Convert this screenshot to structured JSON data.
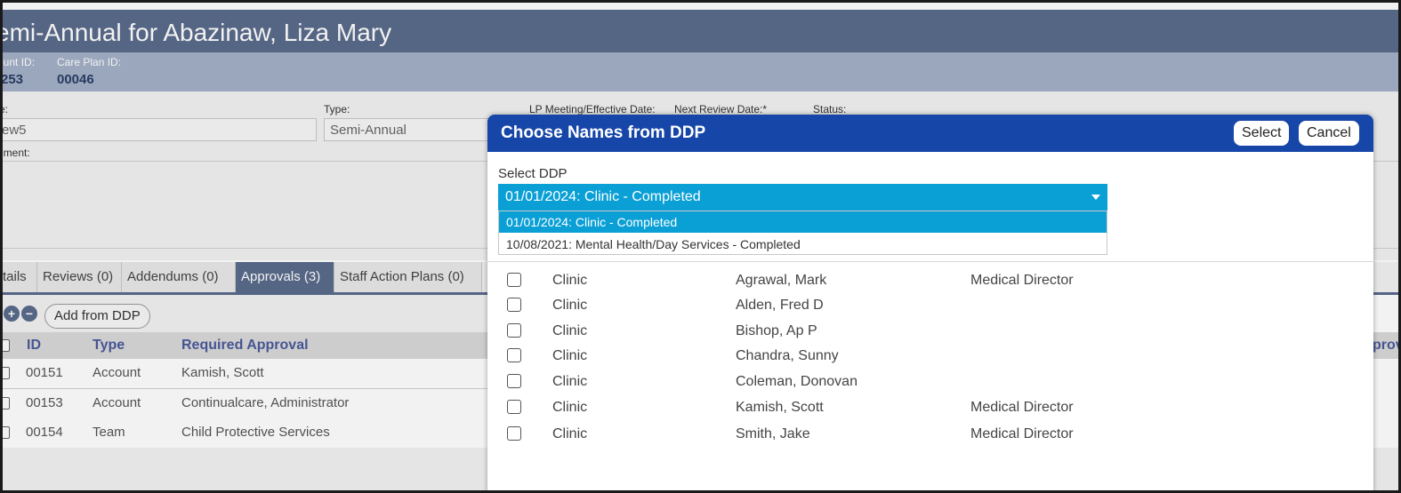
{
  "page": {
    "title": "emi-Annual for Abazinaw, Liza Mary",
    "account_id_label": "ount ID:",
    "account_id_value": "253",
    "care_plan_id_label": "Care Plan ID:",
    "care_plan_id_value": "00046"
  },
  "form": {
    "name_label": "e:",
    "name_value": "ew5",
    "type_label": "Type:",
    "type_value": "Semi-Annual",
    "lp_meeting_label": "LP Meeting/Effective Date:",
    "next_review_label": "Next Review Date:*",
    "status_label": "Status:",
    "comment_label": "nment:"
  },
  "tabs": [
    {
      "label": "tails"
    },
    {
      "label": "Reviews (0)"
    },
    {
      "label": "Addendums (0)"
    },
    {
      "label": "Approvals (3)"
    },
    {
      "label": "Staff Action Plans (0)"
    }
  ],
  "toolbar": {
    "add_icon": "+",
    "remove_icon": "−",
    "add_from_ddp": "Add from DDP"
  },
  "approvals_table": {
    "headers": {
      "id": "ID",
      "type": "Type",
      "required": "Required Approval",
      "right": "prov"
    },
    "rows": [
      {
        "id": "00151",
        "type": "Account",
        "required": "Kamish, Scott"
      },
      {
        "id": "00153",
        "type": "Account",
        "required": "Continualcare, Administrator"
      },
      {
        "id": "00154",
        "type": "Team",
        "required": "Child Protective Services"
      }
    ]
  },
  "modal": {
    "title": "Choose Names from DDP",
    "select_button": "Select",
    "cancel_button": "Cancel",
    "select_label": "Select DDP",
    "selected_value": "01/01/2024: Clinic - Completed",
    "options": [
      "01/01/2024: Clinic - Completed",
      "10/08/2021: Mental Health/Day Services - Completed"
    ],
    "rows": [
      {
        "group": "Clinic",
        "name": "Agrawal, Mark",
        "role": "Medical Director"
      },
      {
        "group": "Clinic",
        "name": "Alden, Fred D",
        "role": ""
      },
      {
        "group": "Clinic",
        "name": "Bishop, Ap P",
        "role": ""
      },
      {
        "group": "Clinic",
        "name": "Chandra, Sunny",
        "role": ""
      },
      {
        "group": "Clinic",
        "name": "Coleman, Donovan",
        "role": ""
      },
      {
        "group": "Clinic",
        "name": "Kamish, Scott",
        "role": "Medical Director"
      },
      {
        "group": "Clinic",
        "name": "Smith, Jake",
        "role": "Medical Director"
      }
    ]
  }
}
